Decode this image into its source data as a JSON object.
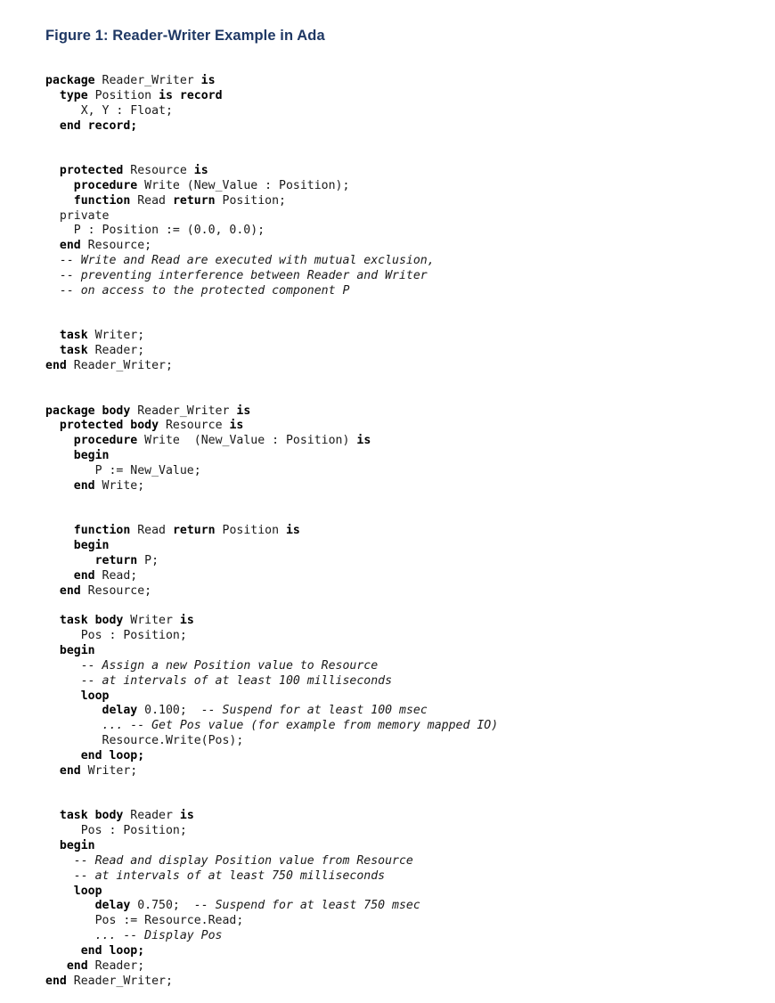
{
  "figure": {
    "title": "Figure 1: Reader-Writer Example in Ada",
    "title_color": "#1f3864",
    "language": "Ada",
    "background_color": "#ffffff",
    "code_color": "#1a1a1a"
  },
  "code": {
    "lines": [
      [
        [
          "kw",
          "package"
        ],
        [
          "plain",
          " Reader_Writer "
        ],
        [
          "kw",
          "is"
        ]
      ],
      [
        [
          "plain",
          "  "
        ],
        [
          "kw",
          "type"
        ],
        [
          "plain",
          " Position "
        ],
        [
          "kw",
          "is"
        ],
        [
          "plain",
          " "
        ],
        [
          "kw",
          "record"
        ]
      ],
      [
        [
          "plain",
          "     X, Y : Float;"
        ]
      ],
      [
        [
          "plain",
          "  "
        ],
        [
          "kw",
          "end record;"
        ]
      ],
      [],
      [],
      [
        [
          "plain",
          "  "
        ],
        [
          "kw",
          "protected"
        ],
        [
          "plain",
          " Resource "
        ],
        [
          "kw",
          "is"
        ]
      ],
      [
        [
          "plain",
          "    "
        ],
        [
          "kw",
          "procedure"
        ],
        [
          "plain",
          " Write (New_Value : Position);"
        ]
      ],
      [
        [
          "plain",
          "    "
        ],
        [
          "kw",
          "function"
        ],
        [
          "plain",
          " Read "
        ],
        [
          "kw",
          "return"
        ],
        [
          "plain",
          " Position;"
        ]
      ],
      [
        [
          "plain",
          "  private"
        ]
      ],
      [
        [
          "plain",
          "    P : Position := (0.0, 0.0);"
        ]
      ],
      [
        [
          "plain",
          "  "
        ],
        [
          "kw",
          "end"
        ],
        [
          "plain",
          " Resource;"
        ]
      ],
      [
        [
          "plain",
          "  "
        ],
        [
          "cmt",
          "-- Write and Read are executed with mutual exclusion,"
        ]
      ],
      [
        [
          "plain",
          "  "
        ],
        [
          "cmt",
          "-- preventing interference between Reader and Writer"
        ]
      ],
      [
        [
          "plain",
          "  "
        ],
        [
          "cmt",
          "-- on access to the protected component P"
        ]
      ],
      [],
      [],
      [
        [
          "plain",
          "  "
        ],
        [
          "kw",
          "task"
        ],
        [
          "plain",
          " Writer;"
        ]
      ],
      [
        [
          "plain",
          "  "
        ],
        [
          "kw",
          "task"
        ],
        [
          "plain",
          " Reader;"
        ]
      ],
      [
        [
          "kw",
          "end"
        ],
        [
          "plain",
          " Reader_Writer;"
        ]
      ],
      [],
      [],
      [
        [
          "kw",
          "package body"
        ],
        [
          "plain",
          " Reader_Writer "
        ],
        [
          "kw",
          "is"
        ]
      ],
      [
        [
          "plain",
          "  "
        ],
        [
          "kw",
          "protected body"
        ],
        [
          "plain",
          " Resource "
        ],
        [
          "kw",
          "is"
        ]
      ],
      [
        [
          "plain",
          "    "
        ],
        [
          "kw",
          "procedure"
        ],
        [
          "plain",
          " Write  (New_Value : Position) "
        ],
        [
          "kw",
          "is"
        ]
      ],
      [
        [
          "plain",
          "    "
        ],
        [
          "kw",
          "begin"
        ]
      ],
      [
        [
          "plain",
          "       P := New_Value;"
        ]
      ],
      [
        [
          "plain",
          "    "
        ],
        [
          "kw",
          "end"
        ],
        [
          "plain",
          " Write;"
        ]
      ],
      [],
      [],
      [
        [
          "plain",
          "    "
        ],
        [
          "kw",
          "function"
        ],
        [
          "plain",
          " Read "
        ],
        [
          "kw",
          "return"
        ],
        [
          "plain",
          " Position "
        ],
        [
          "kw",
          "is"
        ]
      ],
      [
        [
          "plain",
          "    "
        ],
        [
          "kw",
          "begin"
        ]
      ],
      [
        [
          "plain",
          "       "
        ],
        [
          "kw",
          "return"
        ],
        [
          "plain",
          " P;"
        ]
      ],
      [
        [
          "plain",
          "    "
        ],
        [
          "kw",
          "end"
        ],
        [
          "plain",
          " Read;"
        ]
      ],
      [
        [
          "plain",
          "  "
        ],
        [
          "kw",
          "end"
        ],
        [
          "plain",
          " Resource;"
        ]
      ],
      [],
      [
        [
          "plain",
          "  "
        ],
        [
          "kw",
          "task body"
        ],
        [
          "plain",
          " Writer "
        ],
        [
          "kw",
          "is"
        ]
      ],
      [
        [
          "plain",
          "     Pos : Position;"
        ]
      ],
      [
        [
          "plain",
          "  "
        ],
        [
          "kw",
          "begin"
        ]
      ],
      [
        [
          "plain",
          "     "
        ],
        [
          "cmt",
          "-- Assign a new Position value to Resource"
        ]
      ],
      [
        [
          "plain",
          "     "
        ],
        [
          "cmt",
          "-- at intervals of at least 100 milliseconds"
        ]
      ],
      [
        [
          "plain",
          "     "
        ],
        [
          "kw",
          "loop"
        ]
      ],
      [
        [
          "plain",
          "        "
        ],
        [
          "kw",
          "delay"
        ],
        [
          "plain",
          " 0.100;  "
        ],
        [
          "cmt",
          "-- Suspend for at least 100 msec"
        ]
      ],
      [
        [
          "plain",
          "        "
        ],
        [
          "cmt",
          "... -- Get Pos value (for example from memory mapped IO)"
        ]
      ],
      [
        [
          "plain",
          "        Resource.Write(Pos);"
        ]
      ],
      [
        [
          "plain",
          "     "
        ],
        [
          "kw",
          "end loop;"
        ]
      ],
      [
        [
          "plain",
          "  "
        ],
        [
          "kw",
          "end"
        ],
        [
          "plain",
          " Writer;"
        ]
      ],
      [],
      [],
      [
        [
          "plain",
          "  "
        ],
        [
          "kw",
          "task body"
        ],
        [
          "plain",
          " Reader "
        ],
        [
          "kw",
          "is"
        ]
      ],
      [
        [
          "plain",
          "     Pos : Position;"
        ]
      ],
      [
        [
          "plain",
          "  "
        ],
        [
          "kw",
          "begin"
        ]
      ],
      [
        [
          "plain",
          "    "
        ],
        [
          "cmt",
          "-- Read and display Position value from Resource"
        ]
      ],
      [
        [
          "plain",
          "    "
        ],
        [
          "cmt",
          "-- at intervals of at least 750 milliseconds"
        ]
      ],
      [
        [
          "plain",
          "    "
        ],
        [
          "kw",
          "loop"
        ]
      ],
      [
        [
          "plain",
          "       "
        ],
        [
          "kw",
          "delay"
        ],
        [
          "plain",
          " 0.750;  "
        ],
        [
          "cmt",
          "-- Suspend for at least 750 msec"
        ]
      ],
      [
        [
          "plain",
          "       Pos := Resource.Read;"
        ]
      ],
      [
        [
          "plain",
          "       "
        ],
        [
          "cmt",
          "... -- Display Pos"
        ]
      ],
      [
        [
          "plain",
          "     "
        ],
        [
          "kw",
          "end loop;"
        ]
      ],
      [
        [
          "plain",
          "   "
        ],
        [
          "kw",
          "end"
        ],
        [
          "plain",
          " Reader;"
        ]
      ],
      [
        [
          "kw",
          "end"
        ],
        [
          "plain",
          " Reader_Writer;"
        ]
      ]
    ]
  }
}
